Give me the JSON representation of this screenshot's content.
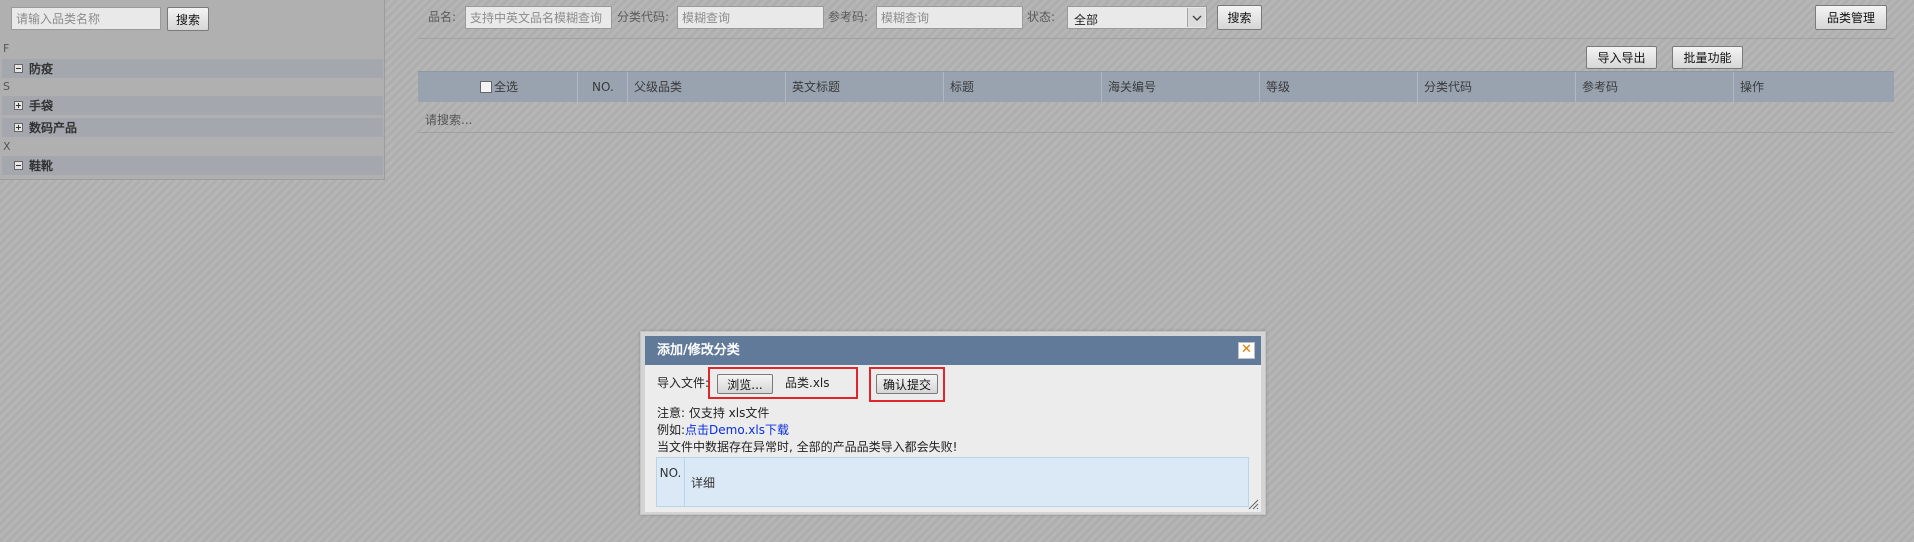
{
  "sidebar": {
    "search_placeholder": "请输入品类名称",
    "search_button": "搜索",
    "tree": [
      {
        "letter": "F"
      },
      {
        "expanded": true,
        "label": "防疫"
      },
      {
        "letter": "S"
      },
      {
        "expanded": false,
        "label": "手袋"
      },
      {
        "expanded": false,
        "label": "数码产品"
      },
      {
        "letter": "X"
      },
      {
        "expanded": true,
        "label": "鞋靴"
      }
    ]
  },
  "filters": {
    "name_label": "品名:",
    "name_placeholder": "支持中英文品名模糊查询",
    "code_label": "分类代码:",
    "code_placeholder": "模糊查询",
    "ref_label": "参考码:",
    "ref_placeholder": "模糊查询",
    "status_label": "状态:",
    "status_value": "全部",
    "search_button": "搜索",
    "manage_button": "品类管理"
  },
  "actions": {
    "import_export": "导入导出",
    "batch": "批量功能"
  },
  "table": {
    "select_all": "全选",
    "columns": [
      "NO.",
      "父级品类",
      "英文标题",
      "标题",
      "海关编号",
      "等级",
      "分类代码",
      "参考码",
      "操作"
    ],
    "empty_text": "请搜索..."
  },
  "dialog": {
    "title": "添加/修改分类",
    "close_icon": "close-icon",
    "file_label": "导入文件:",
    "browse_button": "浏览...",
    "file_name": "品类.xls",
    "submit_button": "确认提交",
    "note": "注意: 仅支持 xls文件",
    "example_prefix": "例如:",
    "example_link": "点击Demo.xls下载",
    "warning": "当文件中数据存在异常时, 全部的产品品类导入都会失败!",
    "table_headers": [
      "NO.",
      "详细"
    ]
  },
  "colors": {
    "dialog_header": "#617a9a",
    "highlight_red": "#e0262b",
    "link_blue": "#0a2ee0"
  }
}
